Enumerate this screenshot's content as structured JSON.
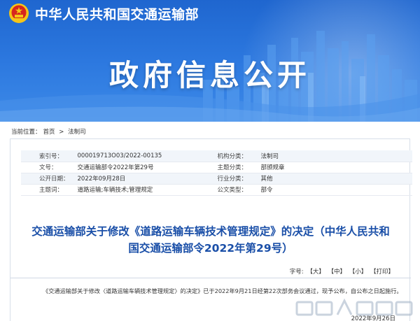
{
  "header": {
    "org_name": "中华人民共和国交通运输部",
    "banner_title": "政府信息公开"
  },
  "breadcrumb": {
    "label": "当前位置：",
    "home": "首页",
    "separator": ">",
    "current": "法制司"
  },
  "meta": {
    "rows": [
      {
        "k1": "索引号：",
        "v1": "000019713O03/2022-00135",
        "k2": "机构分类：",
        "v2": "法制司"
      },
      {
        "k1": "文号：",
        "v1": "交通运输部令2022年第29号",
        "k2": "主题分类：",
        "v2": "部颁规章"
      },
      {
        "k1": "公开日期：",
        "v1": "2022年09月28日",
        "k2": "行业分类：",
        "v2": "其他"
      },
      {
        "k1": "主题词：",
        "v1": "道路运输;车辆技术;管理规定",
        "k2": "公文类型：",
        "v2": "部令"
      }
    ]
  },
  "document": {
    "title_line1": "交通运输部关于修改《道路运输车辆技术管理规定》的决定（中华人民共和",
    "title_line2": "国交通运输部令2022年第29号）",
    "body_line1": "《交通运输部关于修改〈道路运输车辆技术管理规定〉的决定》已于2022年9月21日经第22次部务会议通过，现予公布，自公布之日起施行。",
    "sign_date": "2022年9月26日"
  },
  "font_controls": {
    "label": "字号:",
    "large": "【大】",
    "medium": "【中】",
    "small": "【小】",
    "print": "【打印】"
  },
  "colors": {
    "banner_blue": "#2c78df",
    "title_blue": "#1a4fa8",
    "emblem_red": "#d7261e",
    "emblem_gold": "#f5c518"
  }
}
